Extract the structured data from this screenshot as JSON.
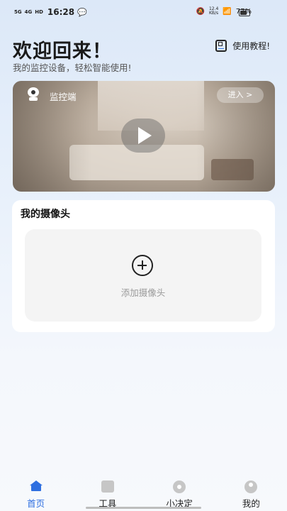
{
  "status_bar": {
    "network_left": "5G",
    "network_right": "4G",
    "hd_badge": "HD",
    "time": "16:28",
    "speed": "12.4\nKB/s",
    "battery": "77%"
  },
  "header": {
    "title": "欢迎回来！",
    "subtitle": "我的监控设备，轻松智能使用!",
    "tutorial_label": "使用教程!"
  },
  "monitor_card": {
    "label": "监控端",
    "enter_label": "进入 >"
  },
  "cameras": {
    "title": "我的摄像头",
    "add_label": "添加摄像头"
  },
  "tabbar": {
    "items": [
      {
        "label": "首页",
        "icon": "home-icon",
        "active": true
      },
      {
        "label": "工具",
        "icon": "tools-box-icon",
        "active": false
      },
      {
        "label": "小决定",
        "icon": "decision-wheel-icon",
        "active": false
      },
      {
        "label": "我的",
        "icon": "profile-icon",
        "active": false
      }
    ],
    "accent_color": "#2f6fe0"
  }
}
